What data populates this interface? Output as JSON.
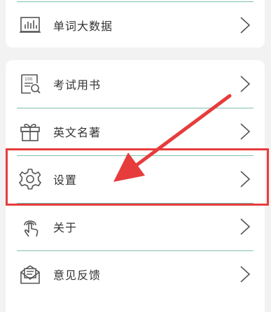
{
  "top_card": {
    "item": {
      "label": "单词大数据",
      "icon": "bar-chart-icon"
    }
  },
  "menu": {
    "items": [
      {
        "label": "考试用书",
        "icon": "book-search-icon"
      },
      {
        "label": "英文名著",
        "icon": "gift-icon"
      },
      {
        "label": "设置",
        "icon": "gear-icon"
      },
      {
        "label": "关于",
        "icon": "touch-hand-icon"
      },
      {
        "label": "意见反馈",
        "icon": "mail-icon"
      }
    ]
  },
  "annotation": {
    "highlighted_item": "设置",
    "color": "#e63c3c"
  },
  "colors": {
    "divider": "#7fbfae",
    "icon": "#555555",
    "text": "#333333",
    "background": "#f2f2f2"
  }
}
